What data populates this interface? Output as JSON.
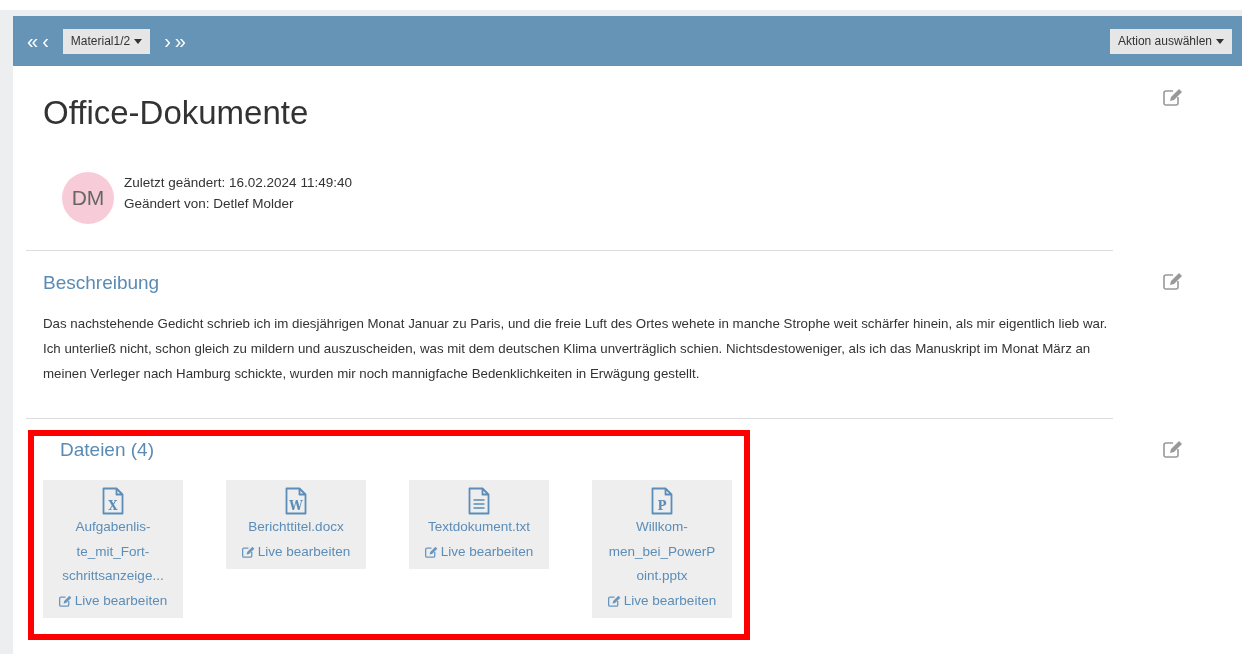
{
  "toolbar": {
    "first": "«",
    "prev": "‹",
    "material": "Material1/2",
    "next": "›",
    "last": "»",
    "action": "Aktion auswählen"
  },
  "title": "Office-Dokumente",
  "meta": {
    "avatar": "DM",
    "changed": "Zuletzt geändert: 16.02.2024 11:49:40",
    "by": "Geändert von: Detlef Molder"
  },
  "description": {
    "heading": "Beschreibung",
    "text": "Das nachstehende Gedicht schrieb ich im diesjährigen Monat Januar zu Paris, und die freie Luft des Ortes wehete in manche Strophe weit schärfer hinein, als mir eigentlich lieb war. Ich unterließ nicht, schon gleich zu mildern und auszuscheiden, was mit dem deutschen Klima unverträglich schien. Nichtsdestoweniger, als ich das Manuskript im Monat März an meinen Verleger nach Hamburg schickte, wurden mir noch mannigfache Bedenklichkeiten in Erwägung gestellt."
  },
  "files": {
    "heading": "Dateien (4)",
    "highlighted": true,
    "items": [
      {
        "kind": "lettered",
        "icon_letter": "X",
        "name_lines": [
          "Aufgabenlis-",
          "te_mit_Fort-",
          "schrittsanzeige..."
        ],
        "action": "Live bearbeiten"
      },
      {
        "kind": "lettered",
        "icon_letter": "W",
        "name_lines": [
          "Berichttitel.docx"
        ],
        "action": "Live bearbeiten"
      },
      {
        "kind": "text",
        "name_lines": [
          "Textdokument.txt"
        ],
        "action": "Live bearbeiten"
      },
      {
        "kind": "lettered",
        "icon_letter": "P",
        "name_lines": [
          "Willkom-",
          "men_bei_PowerP",
          "oint.pptx"
        ],
        "action": "Live bearbeiten"
      }
    ]
  }
}
